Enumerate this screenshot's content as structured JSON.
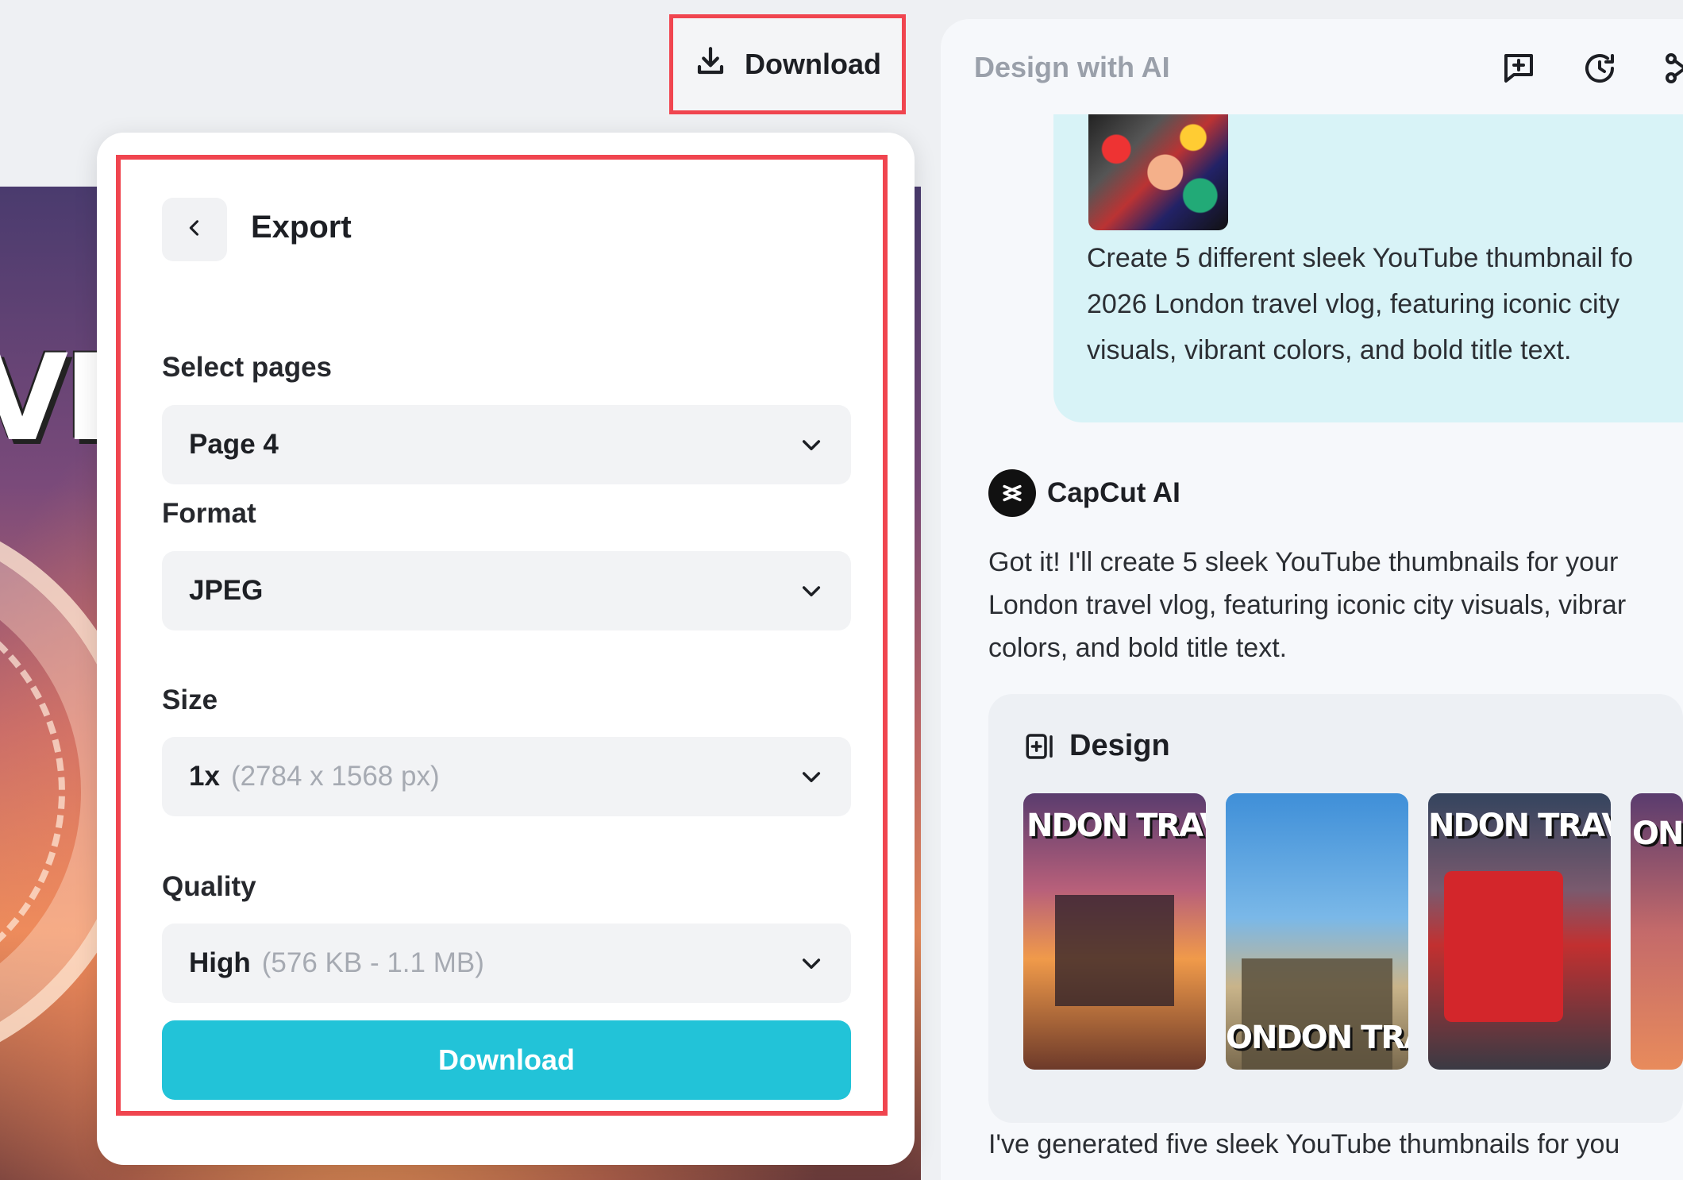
{
  "top_download": {
    "label": "Download"
  },
  "canvas": {
    "visible_text": "VE"
  },
  "export": {
    "title": "Export",
    "fields": [
      {
        "label": "Select pages",
        "value": "Page 4",
        "detail": ""
      },
      {
        "label": "Format",
        "value": "JPEG",
        "detail": ""
      },
      {
        "label": "Size",
        "value": "1x",
        "detail": "(2784 x 1568 px)"
      },
      {
        "label": "Quality",
        "value": "High",
        "detail": "(576 KB - 1.1 MB)"
      }
    ],
    "download_label": "Download",
    "accent_color": "#22c3d8",
    "highlight_color": "#f0454f"
  },
  "ai_panel": {
    "title": "Design with AI",
    "header_icons": [
      "new-chat-icon",
      "history-icon",
      "share-icon"
    ],
    "user_message": {
      "lines": [
        "Create 5 different sleek YouTube thumbnail fo",
        "2026 London travel vlog, featuring iconic city",
        "visuals, vibrant colors, and bold title text."
      ]
    },
    "assistant": {
      "name": "CapCut AI",
      "reply_lines": [
        "Got it! I'll create 5 sleek YouTube thumbnails for your",
        "London travel vlog, featuring iconic city visuals, vibrar",
        "colors, and bold title text."
      ],
      "design_card": {
        "heading": "Design",
        "thumbnails": [
          {
            "text": "NDON TRAV"
          },
          {
            "text": "ONDON TRAVE"
          },
          {
            "text": "NDON TRAV"
          },
          {
            "text": "ON"
          }
        ]
      },
      "footer_line": "I've generated five sleek YouTube thumbnails for you"
    }
  }
}
